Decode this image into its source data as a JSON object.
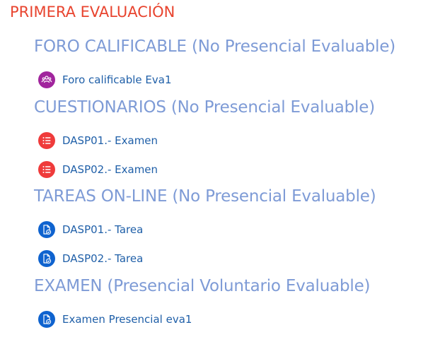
{
  "page": {
    "title": "PRIMERA EVALUACIÓN"
  },
  "colors": {
    "title": "#e8442f",
    "section": "#7e9bd6",
    "link": "#1f5fa8",
    "forum_icon": "#a1259d",
    "quiz_icon": "#ef3b3b",
    "assign_icon": "#0f63cf"
  },
  "sections": [
    {
      "title": "FORO CALIFICABLE (No Presencial Evaluable)",
      "activities": [
        {
          "label": "Foro calificable Eva1",
          "icon": "forum-icon"
        }
      ]
    },
    {
      "title": "CUESTIONARIOS (No Presencial Evaluable)",
      "activities": [
        {
          "label": "DASP01.- Examen",
          "icon": "quiz-icon"
        },
        {
          "label": "DASP02.- Examen",
          "icon": "quiz-icon"
        }
      ]
    },
    {
      "title": "TAREAS ON-LINE (No Presencial Evaluable)",
      "activities": [
        {
          "label": "DASP01.- Tarea",
          "icon": "assignment-icon"
        },
        {
          "label": "DASP02.- Tarea",
          "icon": "assignment-icon"
        }
      ]
    },
    {
      "title": "EXAMEN (Presencial Voluntario Evaluable)",
      "activities": [
        {
          "label": "Examen Presencial eva1",
          "icon": "assignment-icon"
        }
      ]
    }
  ]
}
